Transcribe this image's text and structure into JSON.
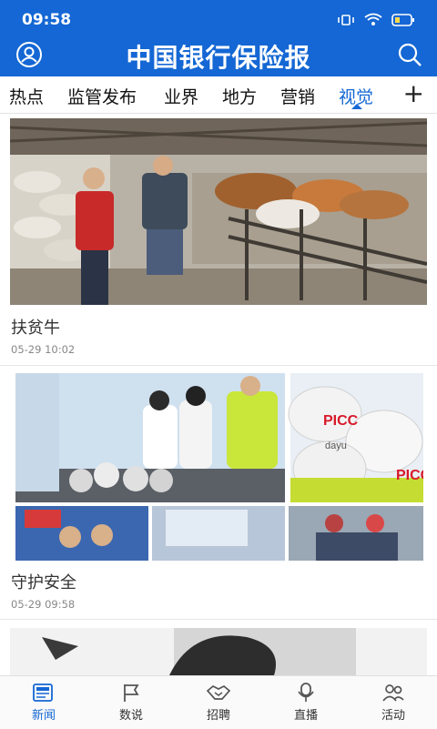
{
  "status": {
    "time": "09:58"
  },
  "header": {
    "title": "中国银行保险报"
  },
  "tabs": [
    "热点",
    "监管发布",
    "业界",
    "地方",
    "营销",
    "视觉"
  ],
  "tabs_more": "+",
  "articles": [
    {
      "caption": "扶贫牛",
      "date": "05-29 10:02"
    },
    {
      "caption": "守护安全",
      "date": "05-29 09:58"
    }
  ],
  "collage_text": {
    "brand": "PICC",
    "brand_sub": "dayu"
  },
  "nav": [
    "新闻",
    "数说",
    "招聘",
    "直播",
    "活动"
  ],
  "colors": {
    "brand": "#1467d4",
    "active_tab": "#1467d4"
  }
}
